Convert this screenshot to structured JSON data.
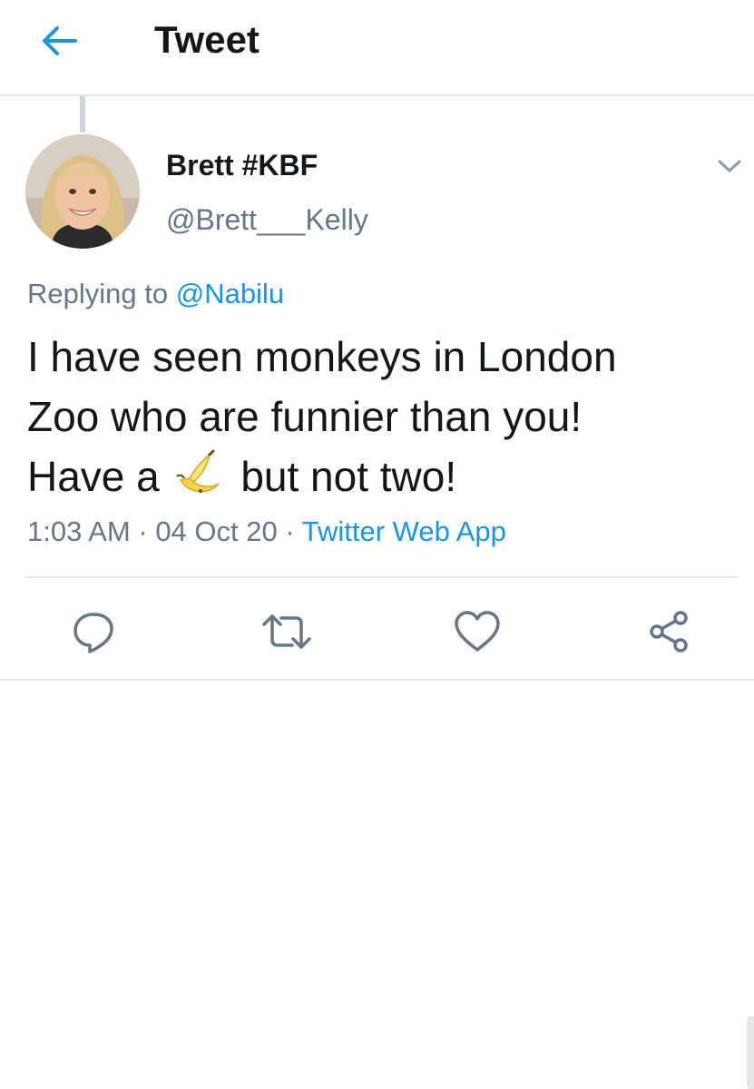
{
  "header": {
    "title": "Tweet",
    "back_icon": "arrow-left-icon"
  },
  "colors": {
    "accent": "#1b95e0",
    "secondary_text": "#657786",
    "divider": "#e1e8ed"
  },
  "tweet": {
    "author": {
      "display_name": "Brett #KBF",
      "handle": "@Brett___Kelly"
    },
    "replying_prefix": "Replying to",
    "replying_to": "@Nabilu",
    "text_line1": "I have seen monkeys in London",
    "text_line2": "Zoo who are funnier than you!",
    "text_line3_before": "Have a",
    "emoji": "banana-emoji",
    "text_line3_after": "but not two!",
    "time": "1:03 AM",
    "sep1": " · ",
    "date": "04 Oct 20",
    "sep2": " · ",
    "source": "Twitter Web App"
  },
  "actions": [
    {
      "name": "reply",
      "icon": "reply-icon"
    },
    {
      "name": "retweet",
      "icon": "retweet-icon"
    },
    {
      "name": "like",
      "icon": "heart-icon"
    },
    {
      "name": "share",
      "icon": "share-icon"
    }
  ]
}
